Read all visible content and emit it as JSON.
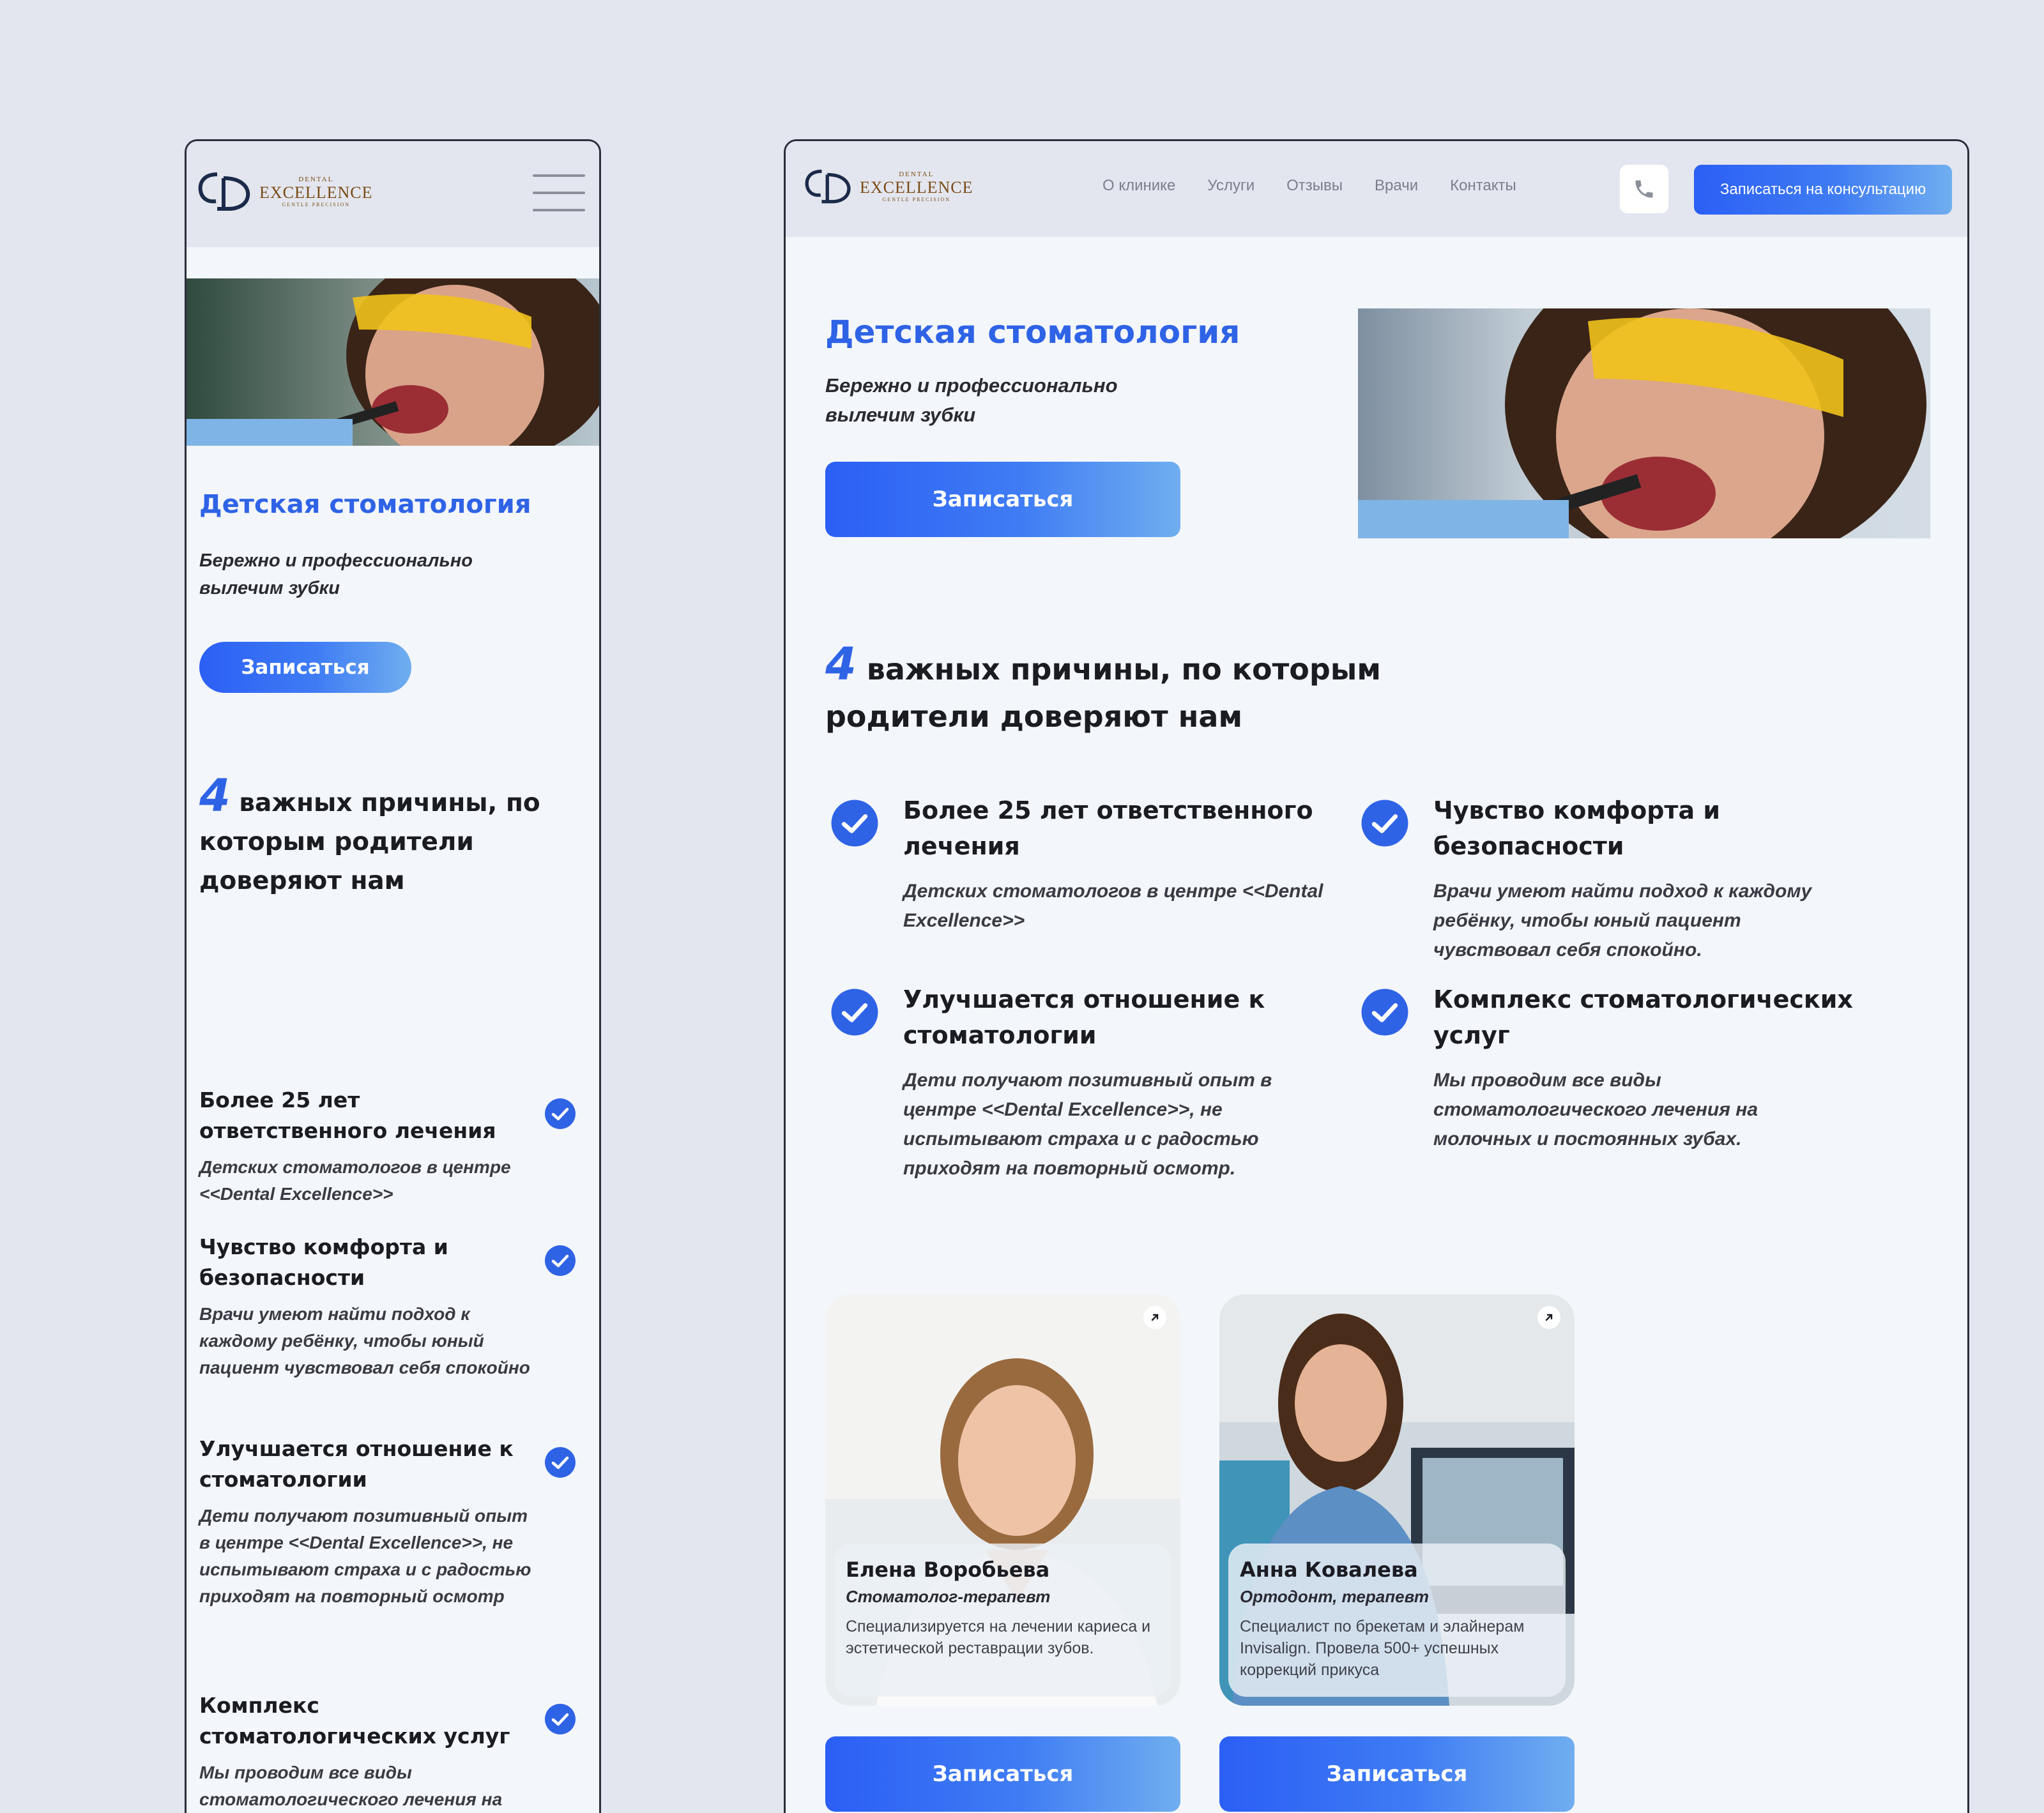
{
  "brand": {
    "dental": "DENTAL",
    "excellence": "EXCELLENCE",
    "tagline": "GENTLE PRECISION"
  },
  "nav": [
    "О клинике",
    "Услуги",
    "Отзывы",
    "Врачи",
    "Контакты"
  ],
  "cta_label": "Записаться на консультацию",
  "hero": {
    "title": "Детская стоматология",
    "subtitle": "Бережно и профессионально вылечим зубки",
    "button": "Записаться"
  },
  "reasons": {
    "number": "4",
    "title_desktop": " важных причины, по которым родители доверяют нам",
    "title_mobile": " важных причины, по которым родители доверяют нам",
    "items": [
      {
        "title": "Более 25 лет ответственного лечения",
        "text": "Детских стоматологов в центре <<Dental Excellence>>"
      },
      {
        "title": "Чувство комфорта и безопасности",
        "text": "Врачи умеют найти подход к каждому ребёнку, чтобы юный пациент чувствовал себя спокойно."
      },
      {
        "title": "Улучшается отношение к стоматологии",
        "text": "Дети получают позитивный опыт в центре <<Dental Excellence>>, не испытывают страха и с радостью приходят на повторный осмотр."
      },
      {
        "title": "Комплекс стоматологических услуг",
        "text": "Мы проводим все виды стоматологического лечения на молочных и постоянных зубах."
      }
    ],
    "mobile_items": [
      {
        "title": "Более 25 лет ответственного лечения",
        "text": "Детских стоматологов в центре <<Dental Excellence>>"
      },
      {
        "title": "Чувство комфорта и безопасности",
        "text": "Врачи умеют найти подход к каждому ребёнку, чтобы юный пациент чувствовал себя спокойно"
      },
      {
        "title": "Улучшается отношение к стоматологии",
        "text": "Дети получают позитивный опыт в центре <<Dental Excellence>>, не испытывают страха и с радостью приходят на повторный осмотр"
      },
      {
        "title": "Комплекс стоматологических услуг",
        "text": "Мы проводим все виды стоматологического лечения на молочных и постоянных зубах"
      }
    ]
  },
  "doctors": [
    {
      "name": "Елена Воробьева",
      "role": "Стоматолог-терапевт",
      "desc": "Специализируется на лечении кариеса и эстетической реставрации зубов.",
      "button": "Записаться"
    },
    {
      "name": "Анна Ковалева",
      "role": "Ортодонт, терапевт",
      "desc": "Специалист по брекетам и элайнерам Invisalign. Провела 500+ успешных коррекций прикуса",
      "button": "Записаться"
    }
  ],
  "colors": {
    "accent": "#2f63e6",
    "background": "#e3e6ee",
    "panel": "#f3f6fa",
    "brand_gold": "#7a4b16"
  },
  "icons": [
    "menu-icon",
    "phone-icon",
    "check-icon",
    "arrow-up-right-icon"
  ]
}
